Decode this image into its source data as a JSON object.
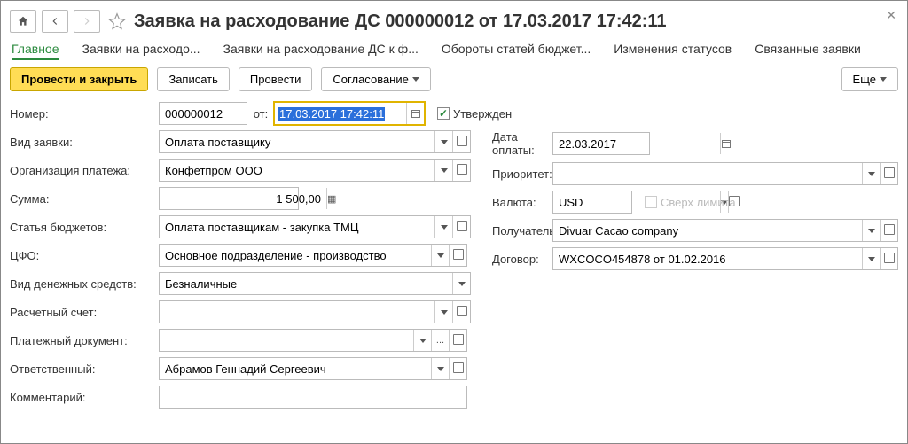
{
  "header": {
    "title": "Заявка на расходование ДС 000000012 от 17.03.2017 17:42:11"
  },
  "tabs": {
    "main": "Главное",
    "apps": "Заявки на расходо...",
    "apps_inv": "Заявки на расходование ДС к ф...",
    "turnover": "Обороты статей бюджет...",
    "status": "Изменения статусов",
    "linked": "Связанные заявки"
  },
  "toolbar": {
    "post_close": "Провести и закрыть",
    "save": "Записать",
    "post": "Провести",
    "approval": "Согласование",
    "more": "Еще"
  },
  "labels": {
    "number": "Номер:",
    "from": "от:",
    "approved": "Утвержден",
    "req_type": "Вид заявки:",
    "pay_date": "Дата оплаты:",
    "pay_org": "Организация платежа:",
    "priority": "Приоритет:",
    "amount": "Сумма:",
    "currency": "Валюта:",
    "over_limit": "Сверх лимита",
    "budget": "Статья бюджетов:",
    "recipient": "Получатель:",
    "cfo": "ЦФО:",
    "contract": "Договор:",
    "cash_type": "Вид денежных средств:",
    "account": "Расчетный счет:",
    "pay_doc": "Платежный документ:",
    "responsible": "Ответственный:",
    "comment": "Комментарий:"
  },
  "values": {
    "number": "000000012",
    "date": "17.03.2017 17:42:11",
    "req_type": "Оплата поставщику",
    "pay_date": "22.03.2017",
    "pay_org": "Конфетпром ООО",
    "priority": "",
    "amount": "1 500,00",
    "currency": "USD",
    "budget": "Оплата поставщикам - закупка ТМЦ",
    "recipient": "Divuar Cacao company",
    "cfo": "Основное подразделение - производство",
    "contract": "WXCOCO454878 от 01.02.2016",
    "cash_type": "Безналичные",
    "account": "",
    "pay_doc": "",
    "responsible": "Абрамов Геннадий Сергеевич",
    "comment": ""
  }
}
